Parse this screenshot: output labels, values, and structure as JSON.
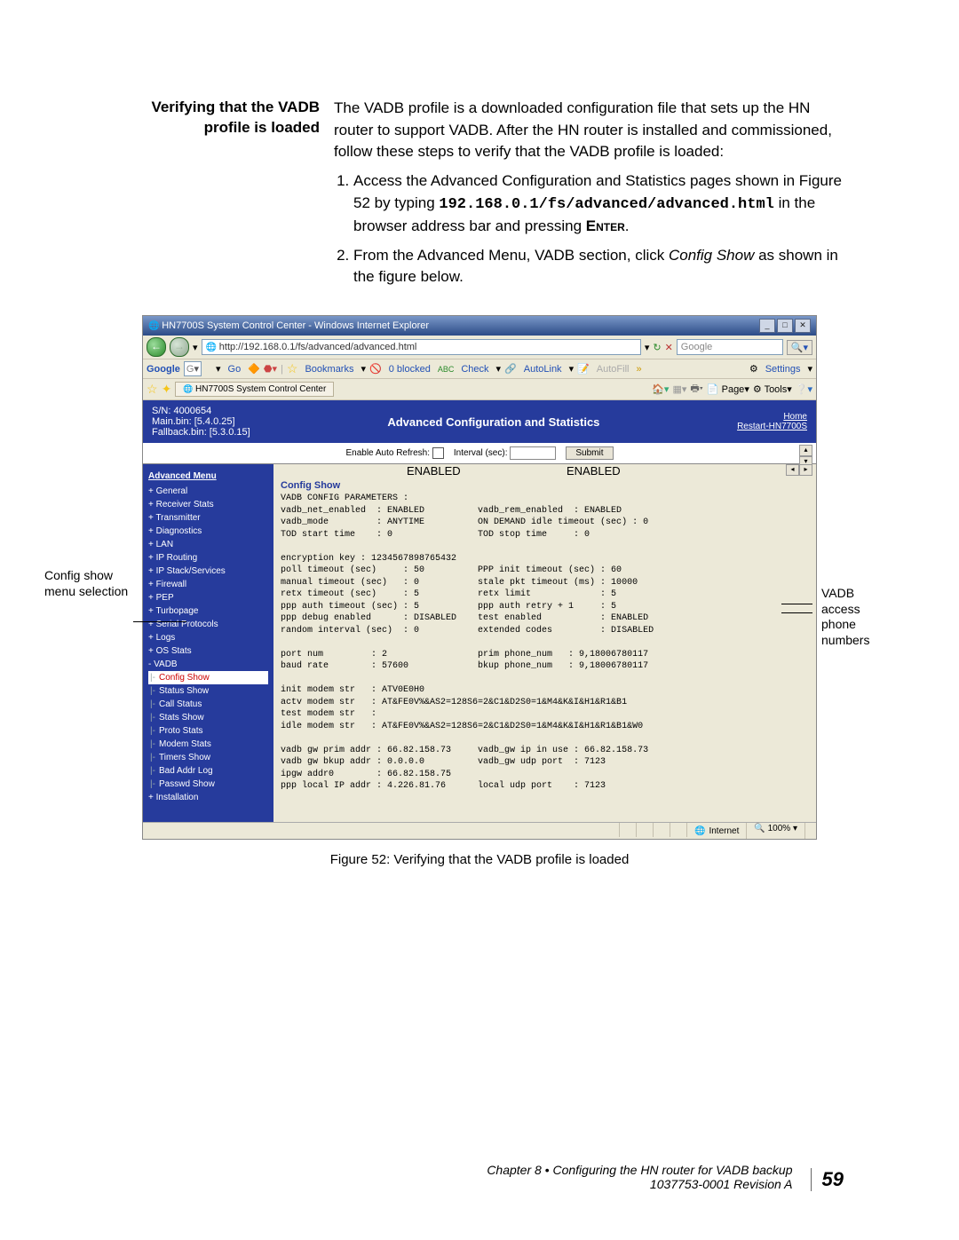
{
  "section": {
    "title": "Verifying that the VADB profile is loaded",
    "intro": "The VADB profile is a downloaded configuration file that sets up the HN router to support VADB. After the HN router is installed and commissioned, follow these steps to verify that the VADB profile is loaded:",
    "step1_pre": "Access the Advanced Configuration and Statistics pages shown in Figure 52 by typing ",
    "step1_url": "192.168.0.1/fs/advanced/advanced.html",
    "step1_post": " in the browser address bar and pressing ",
    "step1_enter": "Enter",
    "step1_end": ".",
    "step2_pre": "From the Advanced Menu, ",
    "step2_vadb": "VADB",
    "step2_mid": " section, click ",
    "step2_link": "Config Show",
    "step2_post": " as shown in the figure below."
  },
  "callouts": {
    "left": "Config show menu selection",
    "right": "VADB access phone numbers"
  },
  "browser": {
    "title": "HN7700S System Control Center - Windows Internet Explorer",
    "address": "http://192.168.0.1/fs/advanced/advanced.html",
    "search_placeholder": "Google",
    "nav_refresh": "↻",
    "nav_stop": "✕",
    "google": {
      "brand": "Google",
      "go": "Go",
      "bookmarks": "Bookmarks",
      "blocked": "0 blocked",
      "check": "Check",
      "autolink": "AutoLink",
      "autofill": "AutoFill",
      "settings": "Settings"
    },
    "tab": "HN7700S System Control Center",
    "ie_tools": {
      "page": "Page",
      "tools": "Tools"
    }
  },
  "bluebar": {
    "sn": "S/N: 4000654",
    "main": "Main.bin: [5.4.0.25]",
    "fallback": "Fallback.bin: [5.3.0.15]",
    "title": "Advanced Configuration and Statistics",
    "home": "Home",
    "restart": "Restart-HN7700S"
  },
  "refresh": {
    "label": "Enable Auto Refresh:",
    "interval": "Interval (sec):",
    "submit": "Submit"
  },
  "sidebar": {
    "header": "Advanced Menu",
    "items": [
      "+ General",
      "+ Receiver Stats",
      "+ Transmitter",
      "+ Diagnostics",
      "+ LAN",
      "+ IP Routing",
      "+ IP Stack/Services",
      "+ Firewall",
      "+ PEP",
      "+ Turbopage",
      "+ Serial Protocols",
      "+ Logs",
      "+ OS Stats",
      "-  VADB"
    ],
    "vadb_sub": [
      "Config Show",
      "Status Show",
      "Call Status",
      "Stats Show",
      "Proto Stats",
      "Modem Stats",
      "Timers Show",
      "Bad Addr Log",
      "Passwd Show"
    ],
    "last": "+ Installation"
  },
  "config": {
    "enabled1": "ENABLED",
    "enabled2": "ENABLED",
    "title": "Config Show",
    "text": "VADB CONFIG PARAMETERS :\nvadb_net_enabled  : ENABLED          vadb_rem_enabled  : ENABLED\nvadb_mode         : ANYTIME          ON DEMAND idle timeout (sec) : 0\nTOD start time    : 0                TOD stop time     : 0\n\nencryption key : 1234567898765432\npoll timeout (sec)     : 50          PPP init timeout (sec) : 60\nmanual timeout (sec)   : 0           stale pkt timeout (ms) : 10000\nretx timeout (sec)     : 5           retx limit             : 5\nppp auth timeout (sec) : 5           ppp auth retry + 1     : 5\nppp debug enabled      : DISABLED    test enabled           : ENABLED\nrandom interval (sec)  : 0           extended codes         : DISABLED\n\nport num         : 2                 prim phone_num   : 9,18006780117\nbaud rate        : 57600             bkup phone_num   : 9,18006780117\n\ninit modem str   : ATV0E0H0\nactv modem str   : AT&FE0V%&AS2=128S6=2&C1&D2S0=1&M4&K&I&H1&R1&B1\ntest modem str   :\nidle modem str   : AT&FE0V%&AS2=128S6=2&C1&D2S0=1&M4&K&I&H1&R1&B1&W0\n\nvadb gw prim addr : 66.82.158.73     vadb_gw ip in use : 66.82.158.73\nvadb gw bkup addr : 0.0.0.0          vadb_gw udp port  : 7123\nipgw addr0        : 66.82.158.75\nppp local IP addr : 4.226.81.76      local udp port    : 7123"
  },
  "statusbar": {
    "internet": "Internet",
    "zoom": "100%"
  },
  "caption": "Figure 52:  Verifying that the VADB profile is loaded",
  "footer": {
    "chapter": "Chapter 8 • Configuring the HN router for VADB backup",
    "doc": "1037753-0001  Revision A",
    "page": "59"
  }
}
